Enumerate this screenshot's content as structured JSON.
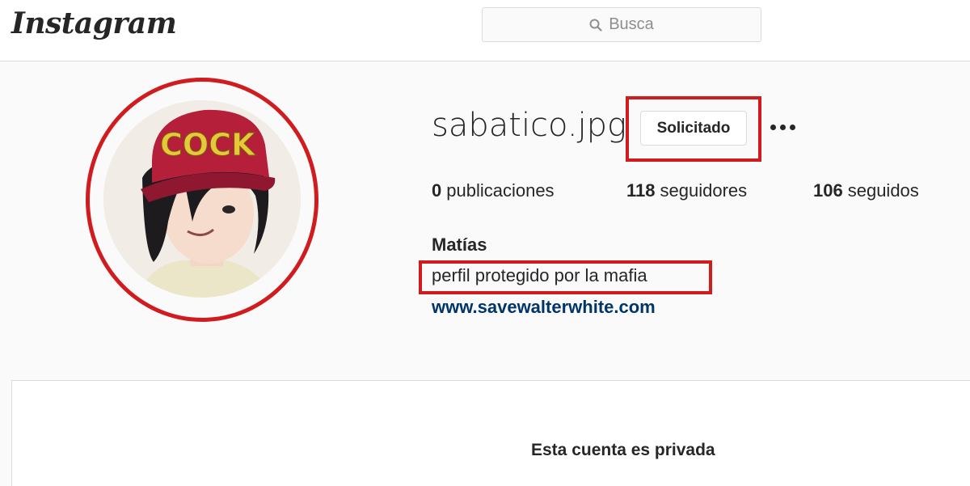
{
  "header": {
    "logo": "Instagram",
    "search": {
      "placeholder": "Busca",
      "icon": "search-icon"
    }
  },
  "profile": {
    "username": "sabatico.jpg",
    "request_button": "Solicitado",
    "more_icon": "more-options-icon",
    "stats": [
      {
        "count": "0",
        "label": "publicaciones"
      },
      {
        "count": "118",
        "label": "seguidores"
      },
      {
        "count": "106",
        "label": "seguidos"
      }
    ],
    "full_name": "Matías",
    "bio": "perfil protegido por la mafia",
    "website": "www.savewalterwhite.com",
    "avatar_text": "COCK"
  },
  "private_notice": "Esta cuenta es privada",
  "colors": {
    "highlight": "#d01c1f",
    "link": "#003569",
    "cap": "#b51f3a",
    "cap_letters": "#e6c93a"
  }
}
